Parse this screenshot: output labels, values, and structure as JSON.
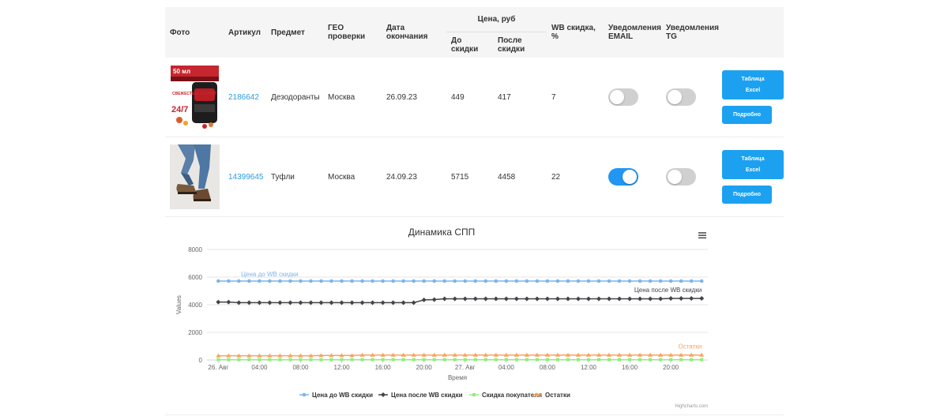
{
  "table": {
    "headers": {
      "photo": "Фото",
      "sku": "Артикул",
      "item": "Предмет",
      "geo": "ГЕО проверки",
      "end_date": "Дата окончания",
      "price_group": "Цена, руб",
      "price_before": "До скидки",
      "price_after": "После скидки",
      "wb_discount": "WB скидка, %",
      "notify_email_1": "Уведомления",
      "notify_email_2": "EMAIL",
      "notify_tg_1": "Уведомления",
      "notify_tg_2": "TG"
    },
    "rows": [
      {
        "sku": "2186642",
        "item": "Дезодоранты",
        "geo": "Москва",
        "end_date": "26.09.23",
        "price_before": "449",
        "price_after": "417",
        "wb_discount": "7",
        "email_on": false,
        "tg_on": false,
        "photo_text_1": "50 мл",
        "photo_text_2": "СВЕЖЕСТЬ И АРОМАТ",
        "photo_text_3": "24/7",
        "btn_table_1": "Таблица",
        "btn_table_2": "Excel",
        "btn_details": "Подробно"
      },
      {
        "sku": "14399645",
        "item": "Туфли",
        "geo": "Москва",
        "end_date": "24.09.23",
        "price_before": "5715",
        "price_after": "4458",
        "wb_discount": "22",
        "email_on": true,
        "tg_on": false,
        "btn_table_1": "Таблица",
        "btn_table_2": "Excel",
        "btn_details": "Подробно"
      }
    ]
  },
  "chart_data": {
    "type": "line",
    "title": "Динамика СПП",
    "xlabel": "Время",
    "ylabel": "Values",
    "ylim": [
      0,
      8000
    ],
    "yticks": [
      "0",
      "2000",
      "4000",
      "6000",
      "8000"
    ],
    "x_tick_labels": [
      "26. Авг",
      "04:00",
      "08:00",
      "12:00",
      "16:00",
      "20:00",
      "27. Авг",
      "04:00",
      "08:00",
      "12:00",
      "16:00",
      "20:00"
    ],
    "x_range_hours": [
      -1.1,
      47.6
    ],
    "grid": true,
    "legend_position": "bottom-center",
    "credit": "Highcharts.com",
    "series": [
      {
        "name": "Цена до WB скидки",
        "color": "#7cb5ec",
        "marker": "circle",
        "label": "Цена до WB скидки",
        "x": [
          0,
          1,
          2,
          3,
          4,
          5,
          6,
          7,
          8,
          9,
          10,
          11,
          12,
          13,
          14,
          15,
          16,
          17,
          18,
          19,
          20,
          21,
          22,
          23,
          24,
          25,
          26,
          27,
          28,
          29,
          30,
          31,
          32,
          33,
          34,
          35,
          36,
          37,
          38,
          39,
          40,
          41,
          42,
          43,
          44,
          45,
          46,
          47
        ],
        "values": [
          5715,
          5715,
          5715,
          5715,
          5715,
          5715,
          5715,
          5715,
          5715,
          5715,
          5715,
          5715,
          5715,
          5715,
          5715,
          5715,
          5715,
          5715,
          5715,
          5715,
          5715,
          5715,
          5715,
          5715,
          5715,
          5715,
          5715,
          5715,
          5715,
          5715,
          5715,
          5715,
          5715,
          5715,
          5715,
          5715,
          5715,
          5715,
          5715,
          5715,
          5715,
          5715,
          5715,
          5715,
          5715,
          5715,
          5715,
          5715
        ]
      },
      {
        "name": "Цена после WB скидки",
        "color": "#434348",
        "marker": "diamond",
        "label": "Цена после WB скидки",
        "x": [
          0,
          1,
          2,
          3,
          4,
          5,
          6,
          7,
          8,
          9,
          10,
          11,
          12,
          13,
          14,
          15,
          16,
          17,
          18,
          19,
          20,
          21,
          22,
          23,
          24,
          25,
          26,
          27,
          28,
          29,
          30,
          31,
          32,
          33,
          34,
          35,
          36,
          37,
          38,
          39,
          40,
          41,
          42,
          43,
          44,
          45,
          46,
          47
        ],
        "values": [
          4190,
          4190,
          4150,
          4150,
          4150,
          4150,
          4150,
          4150,
          4150,
          4150,
          4150,
          4150,
          4150,
          4150,
          4150,
          4150,
          4150,
          4150,
          4150,
          4150,
          4350,
          4370,
          4430,
          4430,
          4430,
          4430,
          4430,
          4430,
          4430,
          4430,
          4430,
          4430,
          4430,
          4430,
          4430,
          4430,
          4430,
          4430,
          4430,
          4430,
          4430,
          4430,
          4430,
          4430,
          4458,
          4458,
          4458,
          4458
        ]
      },
      {
        "name": "Скидка покупателя",
        "color": "#90ed7d",
        "marker": "square",
        "label": "",
        "x": [
          0,
          1,
          2,
          3,
          4,
          5,
          6,
          7,
          8,
          9,
          10,
          11,
          12,
          13,
          14,
          15,
          16,
          17,
          18,
          19,
          20,
          21,
          22,
          23,
          24,
          25,
          26,
          27,
          28,
          29,
          30,
          31,
          32,
          33,
          34,
          35,
          36,
          37,
          38,
          39,
          40,
          41,
          42,
          43,
          44,
          45,
          46,
          47
        ],
        "values": [
          25,
          25,
          25,
          25,
          25,
          25,
          25,
          25,
          25,
          25,
          25,
          25,
          25,
          25,
          25,
          25,
          25,
          25,
          25,
          25,
          25,
          25,
          25,
          25,
          25,
          25,
          25,
          25,
          25,
          25,
          25,
          25,
          25,
          25,
          25,
          25,
          25,
          25,
          25,
          25,
          25,
          25,
          25,
          25,
          25,
          25,
          25,
          25
        ]
      },
      {
        "name": "Остатки",
        "color": "#f7a35c",
        "marker": "triangle",
        "label": "Остатки",
        "x": [
          0,
          1,
          2,
          3,
          4,
          5,
          6,
          7,
          8,
          9,
          10,
          11,
          12,
          13,
          14,
          15,
          16,
          17,
          18,
          19,
          20,
          21,
          22,
          23,
          24,
          25,
          26,
          27,
          28,
          29,
          30,
          31,
          32,
          33,
          34,
          35,
          36,
          37,
          38,
          39,
          40,
          41,
          42,
          43,
          44,
          45,
          46,
          47
        ],
        "values": [
          310,
          310,
          310,
          310,
          310,
          310,
          310,
          310,
          310,
          310,
          330,
          330,
          330,
          330,
          360,
          360,
          360,
          360,
          360,
          360,
          360,
          360,
          360,
          360,
          360,
          360,
          360,
          360,
          360,
          360,
          360,
          360,
          360,
          360,
          360,
          360,
          360,
          360,
          360,
          360,
          360,
          360,
          360,
          360,
          360,
          360,
          360,
          360
        ]
      }
    ]
  }
}
